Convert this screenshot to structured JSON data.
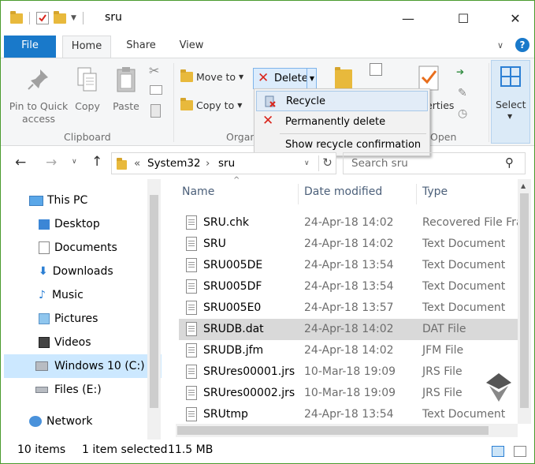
{
  "window": {
    "title": "sru",
    "controls": {
      "minimize": "—",
      "maximize": "☐",
      "close": "✕"
    }
  },
  "tabs": {
    "file": "File",
    "home": "Home",
    "share": "Share",
    "view": "View"
  },
  "ribbon": {
    "pin": "Pin to Quick access",
    "pin_l1": "Pin to Quick",
    "pin_l2": "access",
    "copy": "Copy",
    "paste": "Paste",
    "clipboard_group": "Clipboard",
    "move_to": "Move to",
    "copy_to": "Copy to",
    "delete": "Delete",
    "organize_group": "Organ",
    "properties_partial": "erties",
    "open_group": "Open",
    "select": "Select"
  },
  "delete_menu": {
    "items": [
      "Recycle",
      "Permanently delete",
      "Show recycle confirmation"
    ]
  },
  "nav": {
    "breadcrumb_prefix": "«",
    "breadcrumb": [
      "System32",
      "sru"
    ],
    "search_placeholder": "Search sru"
  },
  "navpane": {
    "items": [
      "This PC",
      "Desktop",
      "Documents",
      "Downloads",
      "Music",
      "Pictures",
      "Videos",
      "Windows 10 (C:)",
      "Files (E:)",
      "Network"
    ]
  },
  "list": {
    "columns": [
      "Name",
      "Date modified",
      "Type"
    ],
    "rows": [
      {
        "name": "SRU.chk",
        "date": "24-Apr-18 14:02",
        "type": "Recovered File Fra"
      },
      {
        "name": "SRU",
        "date": "24-Apr-18 14:02",
        "type": "Text Document"
      },
      {
        "name": "SRU005DE",
        "date": "24-Apr-18 13:54",
        "type": "Text Document"
      },
      {
        "name": "SRU005DF",
        "date": "24-Apr-18 13:54",
        "type": "Text Document"
      },
      {
        "name": "SRU005E0",
        "date": "24-Apr-18 13:57",
        "type": "Text Document"
      },
      {
        "name": "SRUDB.dat",
        "date": "24-Apr-18 14:02",
        "type": "DAT File"
      },
      {
        "name": "SRUDB.jfm",
        "date": "24-Apr-18 14:02",
        "type": "JFM File"
      },
      {
        "name": "SRUres00001.jrs",
        "date": "10-Mar-18 19:09",
        "type": "JRS File"
      },
      {
        "name": "SRUres00002.jrs",
        "date": "10-Mar-18 19:09",
        "type": "JRS File"
      },
      {
        "name": "SRUtmp",
        "date": "24-Apr-18 13:54",
        "type": "Text Document"
      }
    ]
  },
  "status": {
    "count": "10 items",
    "selected": "1 item selected",
    "size": "11.5 MB"
  },
  "colors": {
    "accent": "#1979ca",
    "selection": "#cce8ff",
    "row_selected": "#d9d9d9",
    "delete_red": "#d9251c"
  }
}
